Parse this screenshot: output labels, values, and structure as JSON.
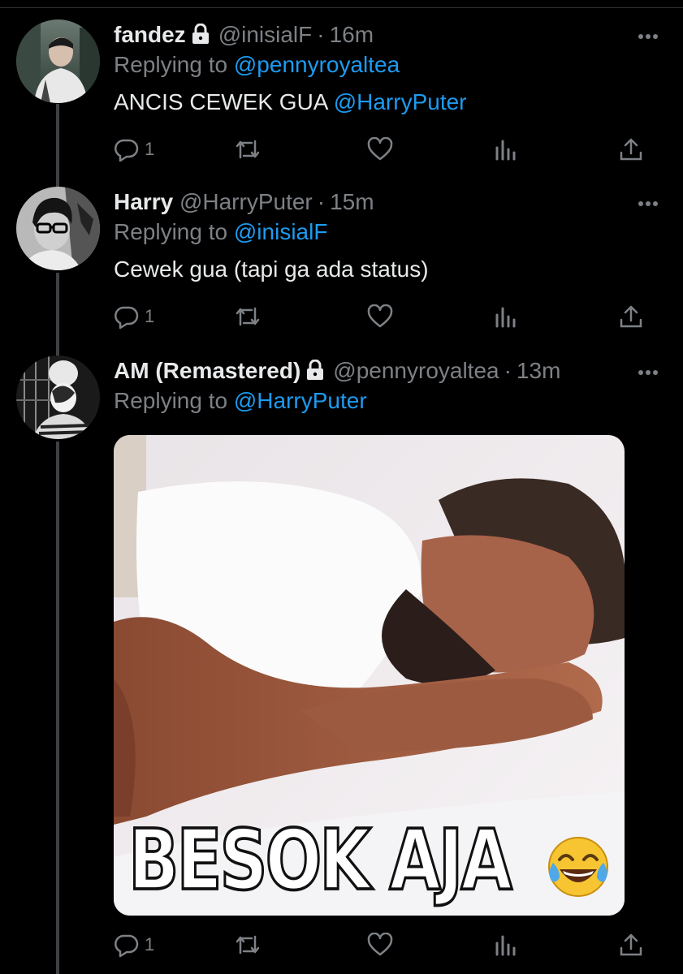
{
  "tweets": [
    {
      "name": "fandez",
      "locked": true,
      "handle": "@inisialF",
      "dot": "·",
      "time": "16m",
      "replying_prefix": "Replying to",
      "replying_to": "@pennyroyaltea",
      "text": "ANCIS CEWEK GUA",
      "text_mention": "@HarryPuter",
      "reply_count": "1"
    },
    {
      "name": "Harry",
      "locked": false,
      "handle": "@HarryPuter",
      "dot": "·",
      "time": "15m",
      "replying_prefix": "Replying to",
      "replying_to": "@inisialF",
      "text": "Cewek gua (tapi ga ada status)",
      "reply_count": "1"
    },
    {
      "name": "AM (Remastered)",
      "locked": true,
      "handle": "@pennyroyaltea",
      "dot": "·",
      "time": "13m",
      "replying_prefix": "Replying to",
      "replying_to": "@HarryPuter",
      "media_caption": "BESOK AJA",
      "media_emoji": "face-with-tears-of-joy",
      "reply_count": "1"
    }
  ],
  "colors": {
    "background": "#000000",
    "text": "#e7e9ea",
    "secondary": "#7d8185",
    "link": "#1d9bf0",
    "thread_line": "#3e4144"
  },
  "icons": [
    "lock-icon",
    "more-icon",
    "reply-icon",
    "retweet-icon",
    "like-icon",
    "analytics-icon",
    "share-icon"
  ]
}
